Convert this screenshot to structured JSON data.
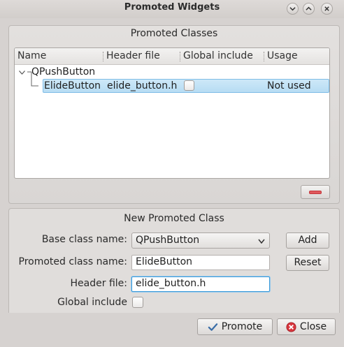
{
  "window": {
    "title": "Promoted Widgets",
    "icons": [
      "chevron-down-icon",
      "chevron-up-icon",
      "close-icon"
    ]
  },
  "promoted_classes": {
    "title": "Promoted Classes",
    "columns": [
      "Name",
      "Header file",
      "Global include",
      "Usage"
    ],
    "parent": "QPushButton",
    "rows": [
      {
        "name": "ElideButton",
        "header_file": "elide_button.h",
        "global_include": false,
        "usage": "Not used"
      }
    ],
    "remove_icon": "minus-icon"
  },
  "new_class": {
    "title": "New Promoted Class",
    "base_class_label": "Base class name:",
    "base_class_value": "QPushButton",
    "promoted_label": "Promoted class name:",
    "promoted_value": "ElideButton",
    "header_label": "Header file:",
    "header_value": "elide_button.h",
    "global_include_label": "Global include",
    "global_include_checked": false,
    "add_label": "Add",
    "reset_label": "Reset"
  },
  "footer": {
    "promote_label": "Promote",
    "close_label": "Close"
  },
  "colors": {
    "selection": "#b7dcf3",
    "close_icon_red": "#d9363e",
    "promote_check_blue": "#3b6ea8"
  }
}
